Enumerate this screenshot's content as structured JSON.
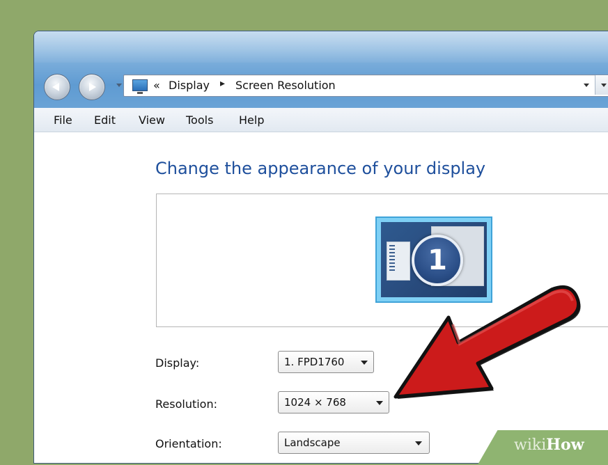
{
  "window": {
    "breadcrumb": {
      "prefix": "«",
      "items": [
        "Display",
        "Screen Resolution"
      ],
      "separator": "▸"
    },
    "menubar": [
      "File",
      "Edit",
      "View",
      "Tools",
      "Help"
    ]
  },
  "main": {
    "title": "Change the appearance of your display",
    "monitor_number": "1",
    "fields": {
      "display": {
        "label": "Display:",
        "value": "1. FPD1760"
      },
      "resolution": {
        "label": "Resolution:",
        "value": "1024 × 768"
      },
      "orientation": {
        "label": "Orientation:",
        "value": "Landscape"
      }
    }
  },
  "annotation": {
    "arrow_color": "#cc1b1b",
    "watermark_wiki": "wiki",
    "watermark_how": "How"
  },
  "colors": {
    "background": "#8fa86a",
    "title_text": "#1e4f9c",
    "monitor_frame": "#7fd0f5"
  }
}
